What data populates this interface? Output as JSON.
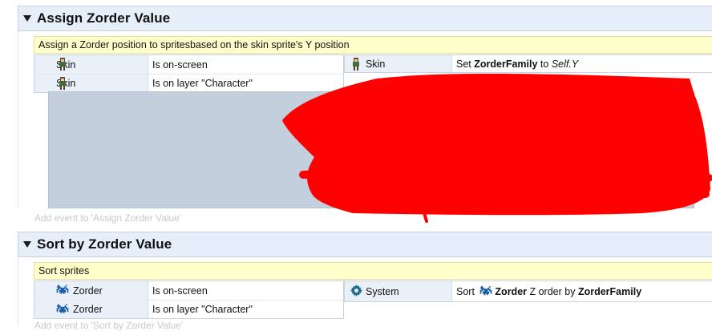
{
  "group1": {
    "title": "Assign Zorder Value",
    "comment": "Assign a Zorder position to spritesbased on the skin sprite's Y position",
    "conditions": [
      {
        "object": "Skin",
        "text": "Is on-screen"
      },
      {
        "object": "Skin",
        "text": "Is on layer \"Character\""
      }
    ],
    "action": {
      "object": "Skin",
      "verb": "Set",
      "target": "ZorderFamily",
      "to": "to",
      "value": "Self.Y"
    },
    "add_event": "Add event to 'Assign Zorder Value'"
  },
  "group2": {
    "title": "Sort by Zorder Value",
    "comment": "Sort sprites",
    "conditions": [
      {
        "object": "Zorder",
        "text": "Is on-screen"
      },
      {
        "object": "Zorder",
        "text": "Is on layer \"Character\""
      }
    ],
    "action": {
      "object": "System",
      "verb": "Sort",
      "target": "Zorder",
      "middle": "Z order by",
      "value": "ZorderFamily"
    },
    "add_event": "Add event to 'Sort by Zorder Value'"
  },
  "colors": {
    "redaction": "#ff0000",
    "header_bg": "#e6eefa",
    "comment_bg": "#ffffcc",
    "object_cell_bg": "#eaf0f8",
    "event_block_bg": "#c4cfdd"
  },
  "icons": {
    "skin": "skin-sprite-icon",
    "zorder": "space-invader-icon",
    "system": "gear-icon"
  }
}
